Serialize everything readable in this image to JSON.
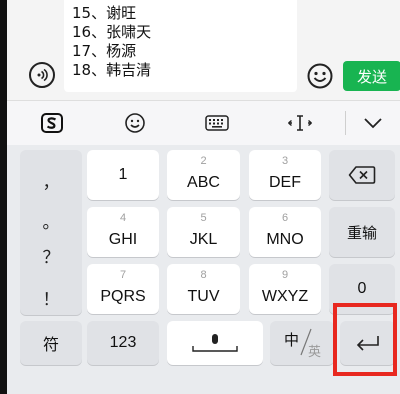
{
  "message": {
    "lines": [
      "15、谢旺",
      "16、张啸天",
      "17、杨源",
      "18、韩吉清"
    ],
    "send_label": "发送"
  },
  "icons": {
    "voice": "voice-icon",
    "emoji": "emoji-icon",
    "sogou": "sogou-logo-icon",
    "toolbar_emoji": "smiley-icon",
    "keyboard": "keyboard-icon",
    "cursor": "cursor-move-icon",
    "collapse": "chevron-down-icon",
    "backspace": "backspace-icon",
    "mic": "microphone-icon",
    "enter": "enter-icon"
  },
  "keyboard": {
    "punct": [
      "，",
      "。",
      "？",
      "！"
    ],
    "keys": [
      {
        "num": "",
        "label": "1"
      },
      {
        "num": "2",
        "label": "ABC"
      },
      {
        "num": "3",
        "label": "DEF"
      },
      {
        "num": "4",
        "label": "GHI"
      },
      {
        "num": "5",
        "label": "JKL"
      },
      {
        "num": "6",
        "label": "MNO"
      },
      {
        "num": "7",
        "label": "PQRS"
      },
      {
        "num": "8",
        "label": "TUV"
      },
      {
        "num": "9",
        "label": "WXYZ"
      }
    ],
    "reinput_label": "重输",
    "zero_label": "0",
    "symbol_label": "符",
    "num_label": "123",
    "lang_zh": "中",
    "lang_en": "英"
  },
  "colors": {
    "send_green": "#18b451",
    "highlight_red": "#e8281f"
  }
}
